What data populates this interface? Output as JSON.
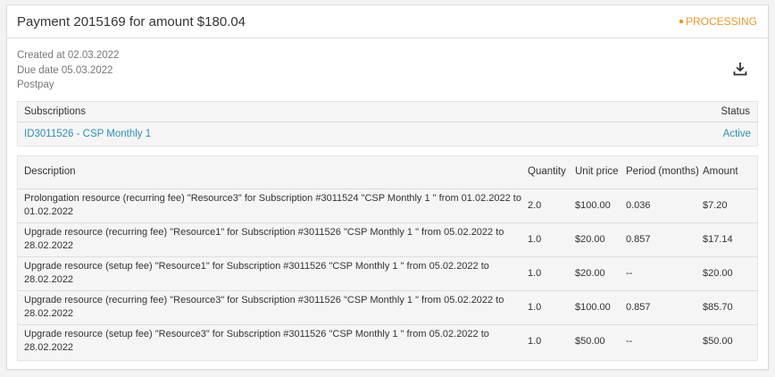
{
  "header": {
    "title": "Payment 2015169 for amount $180.04",
    "status": "PROCESSING",
    "status_color": "#f0962a"
  },
  "meta": {
    "created": "Created at 02.03.2022",
    "due": "Due date 05.03.2022",
    "type": "Postpay"
  },
  "download_icon": "download-icon",
  "subscriptions": {
    "header_label": "Subscriptions",
    "status_label": "Status",
    "items": [
      {
        "name": "ID3011526 - CSP Monthly 1",
        "status": "Active"
      }
    ]
  },
  "lines": {
    "columns": {
      "description": "Description",
      "quantity": "Quantity",
      "unit_price": "Unit price",
      "period": "Period (months)",
      "amount": "Amount"
    },
    "rows": [
      {
        "description": "Prolongation resource (recurring fee) \"Resource3\" for Subscription #3011524 \"CSP Monthly 1 \" from 01.02.2022 to 01.02.2022",
        "quantity": "2.0",
        "unit_price": "$100.00",
        "period": "0.036",
        "amount": "$7.20"
      },
      {
        "description": "Upgrade resource (recurring fee) \"Resource1\" for Subscription #3011526 \"CSP Monthly 1 \" from 05.02.2022 to 28.02.2022",
        "quantity": "1.0",
        "unit_price": "$20.00",
        "period": "0.857",
        "amount": "$17.14"
      },
      {
        "description": "Upgrade resource (setup fee) \"Resource1\" for Subscription #3011526 \"CSP Monthly 1 \" from 05.02.2022 to 28.02.2022",
        "quantity": "1.0",
        "unit_price": "$20.00",
        "period": "--",
        "amount": "$20.00"
      },
      {
        "description": "Upgrade resource (recurring fee) \"Resource3\" for Subscription #3011526 \"CSP Monthly 1 \" from 05.02.2022 to 28.02.2022",
        "quantity": "1.0",
        "unit_price": "$100.00",
        "period": "0.857",
        "amount": "$85.70"
      },
      {
        "description": "Upgrade resource (setup fee) \"Resource3\" for Subscription #3011526 \"CSP Monthly 1 \" from 05.02.2022 to 28.02.2022",
        "quantity": "1.0",
        "unit_price": "$50.00",
        "period": "--",
        "amount": "$50.00"
      }
    ]
  }
}
